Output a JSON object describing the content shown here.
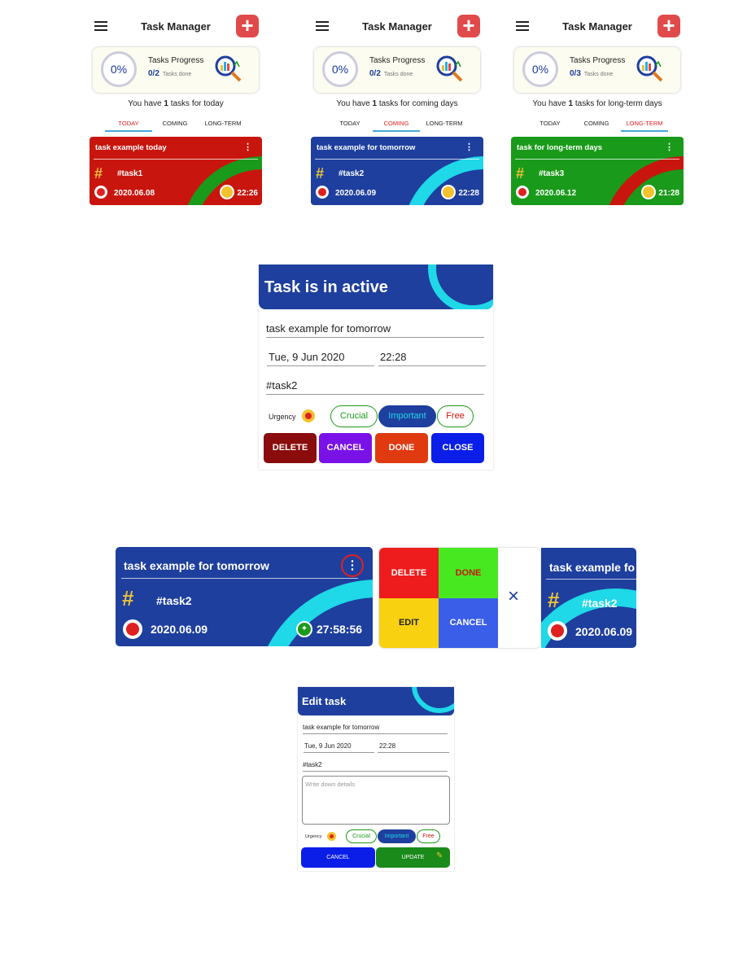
{
  "app_title": "Task Manager",
  "progress_title": "Tasks Progress",
  "tasks_done_label": "Tasks done",
  "tabs": [
    "TODAY",
    "COMING",
    "LONG-TERM"
  ],
  "screens": [
    {
      "percent": "0%",
      "count": "0/2",
      "subtitle_pre": "You have ",
      "subtitle_num": "1",
      "subtitle_post": " tasks for today",
      "active_tab": 0,
      "card": {
        "title": "task example today",
        "tag": "#task1",
        "date": "2020.06.08",
        "time": "22:26",
        "color": "#c8160e",
        "accent": "#1a9a1a"
      }
    },
    {
      "percent": "0%",
      "count": "0/2",
      "subtitle_pre": "You have ",
      "subtitle_num": "1",
      "subtitle_post": " tasks for coming days",
      "active_tab": 1,
      "card": {
        "title": "task example for tomorrow",
        "tag": "#task2",
        "date": "2020.06.09",
        "time": "22:28",
        "color": "#1e3f9e",
        "accent": "#1fd8e8"
      }
    },
    {
      "percent": "0%",
      "count": "0/3",
      "subtitle_pre": "You have ",
      "subtitle_num": "1",
      "subtitle_post": " tasks for long-term days",
      "active_tab": 2,
      "card": {
        "title": "task for long-term days",
        "tag": "#task3",
        "date": "2020.06.12",
        "time": "21:28",
        "color": "#1a9a1a",
        "accent": "#c8160e"
      }
    }
  ],
  "active_dialog": {
    "title": "Task is in active",
    "task_name": "task example for tomorrow",
    "date": "Tue, 9 Jun 2020",
    "time": "22:28",
    "tag": "#task2",
    "urgency_label": "Urgency",
    "urgency": [
      "Crucial",
      "Important",
      "Free"
    ],
    "buttons": [
      "DELETE",
      "CANCEL",
      "DONE",
      "CLOSE"
    ]
  },
  "swipe_row": {
    "card_title": "task example for tomorrow",
    "tag": "#task2",
    "date": "2020.06.09",
    "countdown": "27:58:56",
    "menu": [
      "DELETE",
      "DONE",
      "EDIT",
      "CANCEL"
    ],
    "close_glyph": "×",
    "peek_title": "task example fo",
    "peek_tag": "#task2",
    "peek_date": "2020.06.09"
  },
  "edit_dialog": {
    "title": "Edit task",
    "task_name": "task example for tomorrow",
    "date": "Tue, 9 Jun 2020",
    "time": "22:28",
    "tag": "#task2",
    "details_placeholder": "Write down details",
    "urgency_label": "Urgency",
    "urgency": [
      "Crucial",
      "Important",
      "Free"
    ],
    "cancel": "CANCEL",
    "update": "UPDATE"
  },
  "colors": {
    "blue": "#1e3f9e",
    "cyan": "#1fd8e8",
    "red": "#c8160e",
    "green": "#1a9a1a"
  }
}
